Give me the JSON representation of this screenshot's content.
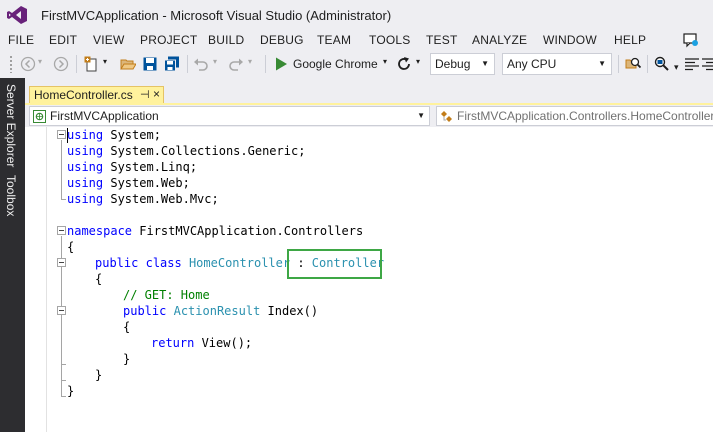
{
  "window": {
    "title": "FirstMVCApplication - Microsoft Visual Studio (Administrator)"
  },
  "menu": {
    "items": [
      "FILE",
      "EDIT",
      "VIEW",
      "PROJECT",
      "BUILD",
      "DEBUG",
      "TEAM",
      "TOOLS",
      "TEST",
      "ANALYZE",
      "WINDOW",
      "HELP"
    ]
  },
  "toolbar": {
    "run_target": "Google Chrome",
    "configuration": "Debug",
    "platform": "Any CPU"
  },
  "side_strip": {
    "server_explorer": "Server Explorer",
    "toolbox": "Toolbox"
  },
  "document_tab": {
    "filename": "HomeController.cs",
    "pin_glyph": "⊣",
    "close_glyph": "×"
  },
  "navigation": {
    "project_scope": "FirstMVCApplication",
    "type_scope": "FirstMVCApplication.Controllers.HomeController"
  },
  "code": {
    "line1": {
      "kw": "using",
      "rest": " System;"
    },
    "line2": {
      "kw": "using",
      "rest": " System.Collections.Generic;"
    },
    "line3": {
      "kw": "using",
      "rest": " System.Linq;"
    },
    "line4": {
      "kw": "using",
      "rest": " System.Web;"
    },
    "line5": {
      "kw": "using",
      "rest": " System.Web.Mvc;"
    },
    "line7": {
      "kw": "namespace",
      "rest": " FirstMVCApplication.Controllers"
    },
    "line8": {
      "text": "{"
    },
    "line9": {
      "kw1": "public",
      "kw2": "class",
      "type": "HomeController",
      "sep": " : ",
      "base": "Controller"
    },
    "line10": {
      "text": "{"
    },
    "line11": {
      "comment": "// GET: Home"
    },
    "line12": {
      "kw": "public",
      "type": "ActionResult",
      "rest": " Index()"
    },
    "line13": {
      "text": "{"
    },
    "line14": {
      "kw": "return",
      "rest": " View();"
    },
    "line15": {
      "text": "}"
    },
    "line16": {
      "text": "}"
    },
    "line17": {
      "text": "}"
    }
  },
  "colors": {
    "keyword": "#0000ff",
    "type": "#2b91af",
    "comment": "#008000",
    "highlight": "#3ea745",
    "active_tab": "#fff29d"
  }
}
